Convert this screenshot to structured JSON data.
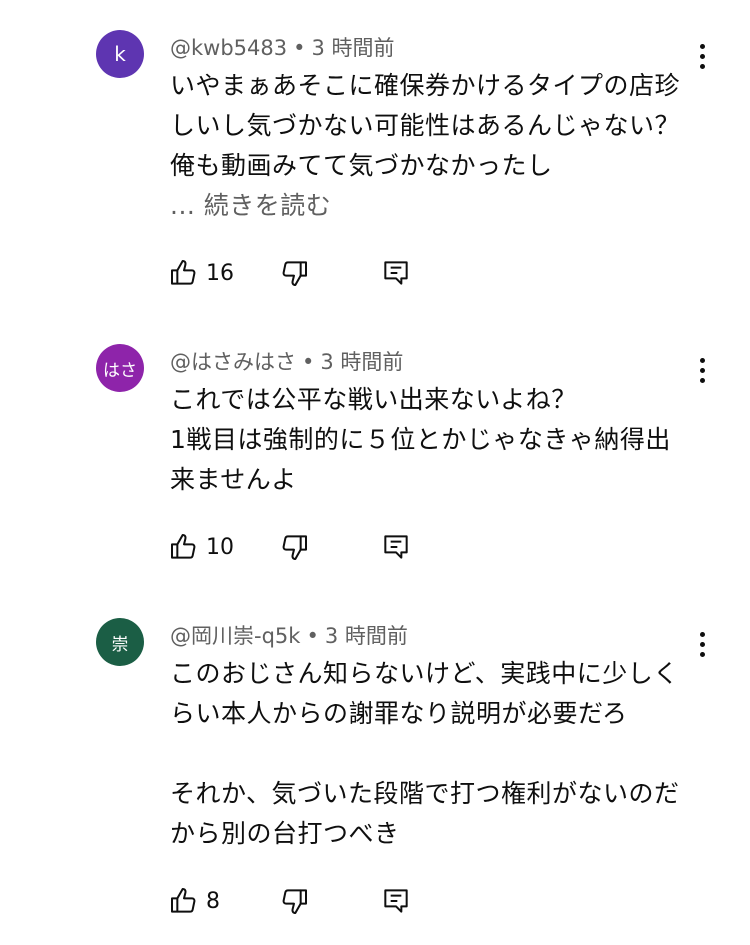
{
  "comments": [
    {
      "avatar_letter": "k",
      "avatar_color": "#5e35b1",
      "handle": "@kwb5483",
      "time": "3 時間前",
      "text": "いやまぁあそこに確保券かけるタイプの店珍\nしいし気づかない可能性はあるんじゃない？\n俺も動画みてて気づかなかったし",
      "read_more": "... 続きを読む",
      "likes": "16"
    },
    {
      "avatar_letter": "はさ",
      "avatar_color": "#8e24aa",
      "handle": "@はさみはさ",
      "time": "3 時間前",
      "text": "これでは公平な戦い出来ないよね？\n1戦目は強制的に５位とかじゃなきゃ納得出\n来ませんよ",
      "likes": "10"
    },
    {
      "avatar_letter": "崇",
      "avatar_color": "#1b5e45",
      "handle": "@岡川崇-q5k",
      "time": "3 時間前",
      "text": "このおじさん知らないけど、実践中に少しく\nらい本人からの謝罪なり説明が必要だろ\n\nそれか、気づいた段階で打つ権利がないのだ\nから別の台打つべき",
      "likes": "8"
    }
  ],
  "icons": {
    "like": "thumbs-up-icon",
    "dislike": "thumbs-down-icon",
    "reply": "reply-comment-icon",
    "menu": "more-vertical-icon"
  }
}
